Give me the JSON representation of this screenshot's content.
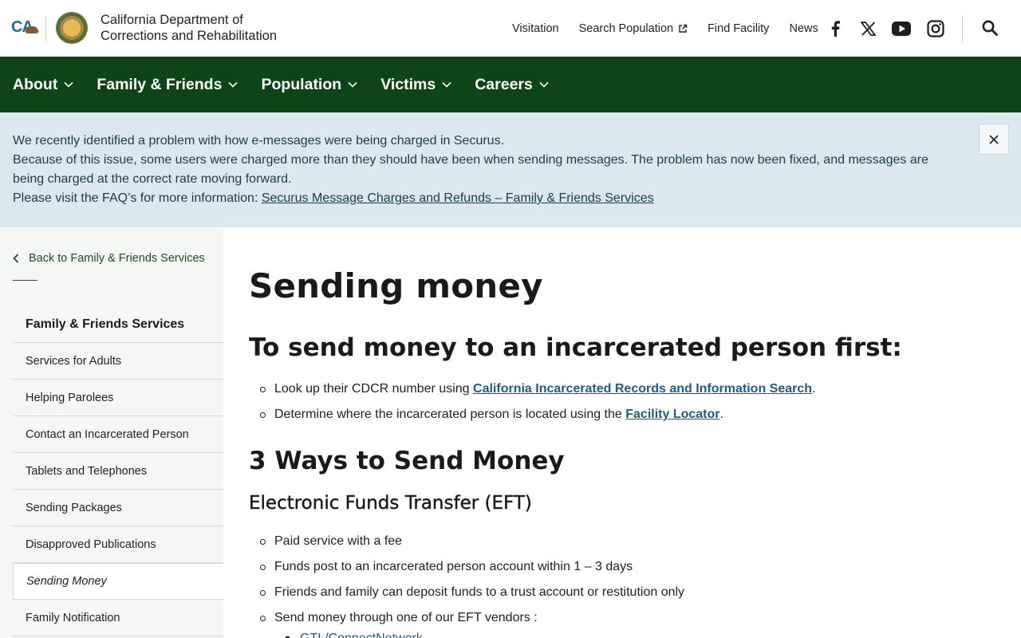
{
  "header": {
    "org_line1": "California Department of",
    "org_line2": "Corrections and Rehabilitation",
    "ca_logo_text": "CA",
    "utility_links": [
      "Visitation",
      "Search Population",
      "Find Facility",
      "News"
    ],
    "social_icons": [
      "facebook-icon",
      "x-icon",
      "youtube-icon",
      "instagram-icon"
    ]
  },
  "nav": {
    "items": [
      "About",
      "Family & Friends",
      "Population",
      "Victims",
      "Careers"
    ]
  },
  "alert": {
    "line1": "We recently identified a problem with how e-messages were being charged in Securus.",
    "line2": "Because of this issue, some users were charged more than they should have been when sending messages. The problem has now been fixed, and messages are being charged at the correct rate moving forward.",
    "line3_prefix": "Please visit the FAQ’s for more information: ",
    "line3_link": "Securus Message Charges and Refunds – Family & Friends Services"
  },
  "sidebar": {
    "back_label": "Back to Family & Friends Services",
    "heading": "Family & Friends Services",
    "items": [
      "Services for Adults",
      "Helping Parolees",
      "Contact an Incarcerated Person",
      "Tablets and Telephones",
      "Sending Packages",
      "Disapproved Publications",
      "Sending Money",
      "Family Notification"
    ],
    "active_index": 6
  },
  "content": {
    "title": "Sending money",
    "h2_first": "To send money to an incarcerated person first:",
    "first_list": {
      "item1_prefix": "Look up their CDCR number using ",
      "item1_link": "California Incarcerated Records and Information Search",
      "item1_suffix": ".",
      "item2_prefix": "Determine where the incarcerated person is located using the ",
      "item2_link": "Facility Locator",
      "item2_suffix": "."
    },
    "h2_ways": "3 Ways to Send Money",
    "h3_eft": "Electronic Funds Transfer (EFT)",
    "eft_list": [
      "Paid service with a fee",
      "Funds post to an incarcerated person account within 1 – 3 days",
      "Friends and family can deposit funds to a trust account or restitution only",
      "Send money through one of our EFT vendors :"
    ],
    "vendor_list": [
      "GTL/ConnectNetwork"
    ]
  },
  "colors": {
    "nav_green": "#0e4416",
    "alert_blue": "#dbe8f0",
    "link_blue": "#1f5b86",
    "sidebar_bg": "#f5f7f4"
  }
}
